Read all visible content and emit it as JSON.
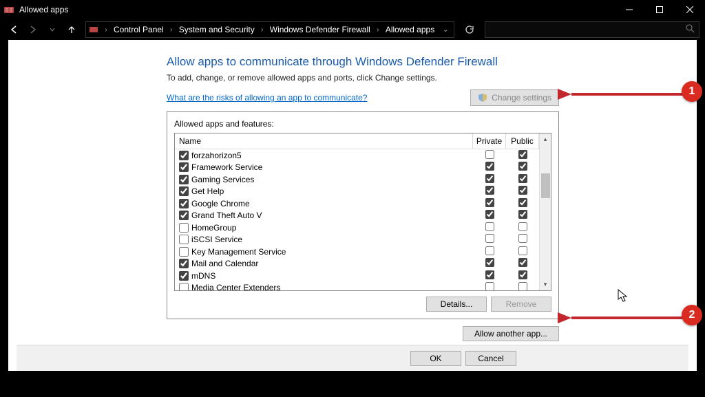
{
  "window": {
    "title": "Allowed apps"
  },
  "breadcrumb": {
    "items": [
      "Control Panel",
      "System and Security",
      "Windows Defender Firewall",
      "Allowed apps"
    ]
  },
  "page": {
    "heading": "Allow apps to communicate through Windows Defender Firewall",
    "subtext": "To add, change, or remove allowed apps and ports, click Change settings.",
    "risk_link": "What are the risks of allowing an app to communicate?",
    "change_settings": "Change settings"
  },
  "list": {
    "label": "Allowed apps and features:",
    "headers": {
      "name": "Name",
      "private": "Private",
      "public": "Public"
    },
    "rows": [
      {
        "on": true,
        "name": "forzahorizon5",
        "priv": false,
        "pub": true
      },
      {
        "on": true,
        "name": "Framework Service",
        "priv": true,
        "pub": true
      },
      {
        "on": true,
        "name": "Gaming Services",
        "priv": true,
        "pub": true
      },
      {
        "on": true,
        "name": "Get Help",
        "priv": true,
        "pub": true
      },
      {
        "on": true,
        "name": "Google Chrome",
        "priv": true,
        "pub": true
      },
      {
        "on": true,
        "name": "Grand Theft Auto V",
        "priv": true,
        "pub": true
      },
      {
        "on": false,
        "name": "HomeGroup",
        "priv": false,
        "pub": false
      },
      {
        "on": false,
        "name": "iSCSI Service",
        "priv": false,
        "pub": false
      },
      {
        "on": false,
        "name": "Key Management Service",
        "priv": false,
        "pub": false
      },
      {
        "on": true,
        "name": "Mail and Calendar",
        "priv": true,
        "pub": true
      },
      {
        "on": true,
        "name": "mDNS",
        "priv": true,
        "pub": true
      },
      {
        "on": false,
        "name": "Media Center Extenders",
        "priv": false,
        "pub": false
      }
    ],
    "details_btn": "Details...",
    "remove_btn": "Remove",
    "allow_another": "Allow another app..."
  },
  "footer": {
    "ok": "OK",
    "cancel": "Cancel"
  },
  "annotations": {
    "badge1": "1",
    "badge2": "2"
  }
}
